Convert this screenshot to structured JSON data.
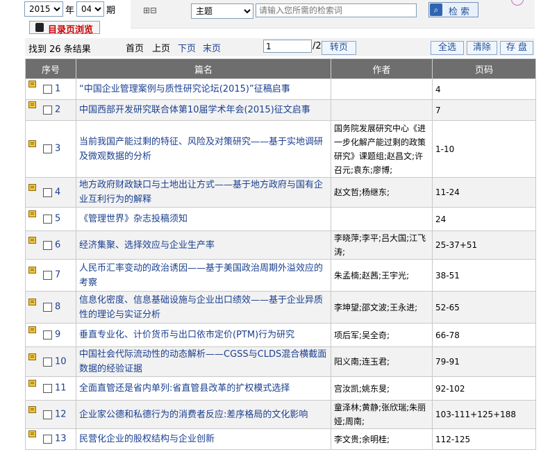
{
  "filter": {
    "year": "2015",
    "year_label": "年",
    "issue": "04",
    "issue_label": "期",
    "catalog_button": "目录页浏览",
    "expand_glyph": "⊞⊟",
    "field": "主题",
    "search_placeholder": "请输入您所需的检索词",
    "search_button": "检 索"
  },
  "toolbar": {
    "result_text": "找到 26 条结果",
    "first": "首页",
    "prev": "上页",
    "next": "下页",
    "last": "末页",
    "page_value": "1",
    "page_total": "/2",
    "goto": "转页",
    "select_all": "全选",
    "clear": "清除",
    "save": "存 盘"
  },
  "table": {
    "headers": [
      "序号",
      "篇名",
      "作者",
      "页码"
    ],
    "rows": [
      {
        "num": "1",
        "title": "“中国企业管理案例与质性研究论坛(2015)”征稿启事",
        "author": "",
        "pages": "4"
      },
      {
        "num": "2",
        "title": "中国西部开发研究联合体第10届学术年会(2015)征文启事",
        "author": "",
        "pages": "7"
      },
      {
        "num": "3",
        "title": "当前我国产能过剩的特征、风险及对策研究——基于实地调研及微观数据的分析",
        "author": "国务院发展研究中心《进一步化解产能过剩的政策研究》课题组;赵昌文;许召元;袁东;廖博;",
        "pages": "1-10"
      },
      {
        "num": "4",
        "title": "地方政府财政缺口与土地出让方式——基于地方政府与国有企业互利行为的解释",
        "author": "赵文哲;杨继东;",
        "pages": "11-24"
      },
      {
        "num": "5",
        "title": "《管理世界》杂志投稿须知",
        "author": "",
        "pages": "24"
      },
      {
        "num": "6",
        "title": "经济集聚、选择效应与企业生产率",
        "author": "李晓萍;李平;吕大国;江飞涛;",
        "pages": "25-37+51"
      },
      {
        "num": "7",
        "title": "人民币汇率变动的政治诱因——基于美国政治周期外溢效应的考察",
        "author": "朱孟楠;赵茜;王宇光;",
        "pages": "38-51"
      },
      {
        "num": "8",
        "title": "信息化密度、信息基础设施与企业出口绩效——基于企业异质性的理论与实证分析",
        "author": "李坤望;邵文波;王永进;",
        "pages": "52-65"
      },
      {
        "num": "9",
        "title": "垂直专业化、计价货币与出口依市定价(PTM)行为研究",
        "author": "项后军;吴全奇;",
        "pages": "66-78"
      },
      {
        "num": "10",
        "title": "中国社会代际流动性的动态解析——CGSS与CLDS混合横截面数据的经验证据",
        "author": "阳义南;连玉君;",
        "pages": "79-91"
      },
      {
        "num": "11",
        "title": "全面直管还是省内单列:省直管县改革的扩权模式选择",
        "author": "宫汝凯;姚东旻;",
        "pages": "92-102"
      },
      {
        "num": "12",
        "title": "企业家公德和私德行为的消费者反应:差序格局的文化影响",
        "author": "童泽林;黄静;张欣瑞;朱丽娅;周南;",
        "pages": "103-111+125+188"
      },
      {
        "num": "13",
        "title": "民营化企业的股权结构与企业创新",
        "author": "李文贵;余明桂;",
        "pages": "112-125"
      }
    ]
  },
  "colors": {
    "header_bg": "#6e6e6e",
    "link": "#1a3f8f",
    "catalog_text": "#cc0000"
  }
}
